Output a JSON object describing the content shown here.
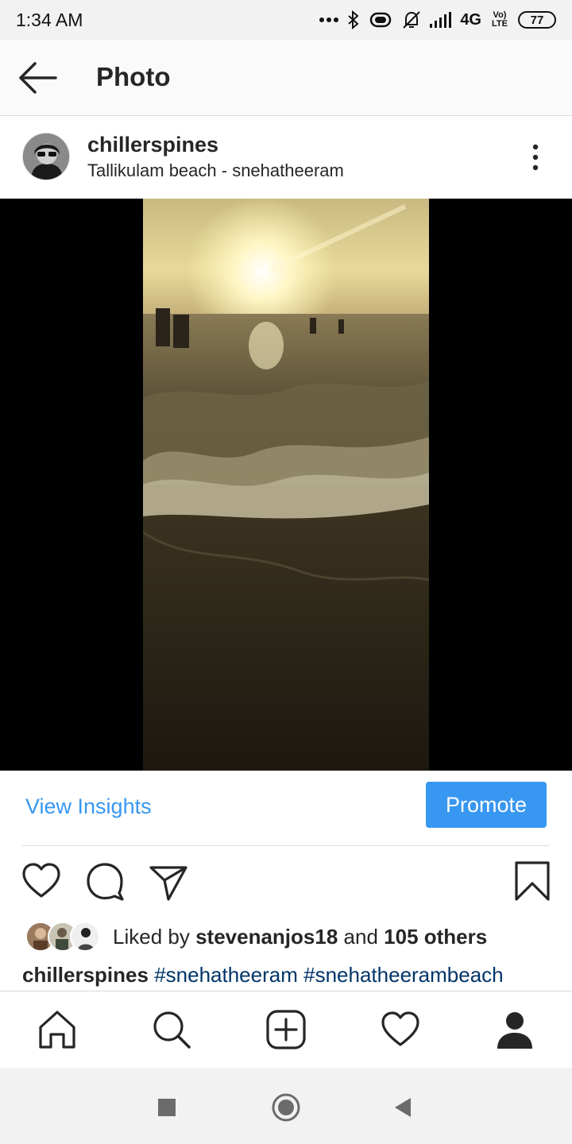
{
  "status_bar": {
    "time": "1:34 AM",
    "network": "4G",
    "lte_label": "Vo) LTE",
    "battery": "77",
    "icons": [
      "dots-icon",
      "bluetooth-icon",
      "vibrate-icon",
      "mute-icon",
      "signal-icon"
    ]
  },
  "header": {
    "title": "Photo",
    "back_icon": "arrow-left-icon"
  },
  "post": {
    "username": "chillerspines",
    "location": "Tallikulam beach - snehatheeram",
    "more_icon": "more-vertical-icon"
  },
  "insights": {
    "view_insights_label": "View Insights",
    "promote_label": "Promote"
  },
  "actions": [
    "heart-icon",
    "comment-icon",
    "send-icon",
    "bookmark-icon"
  ],
  "likes": {
    "prefix": "Liked by",
    "user": "stevenanjos18",
    "middle": "and",
    "others": "105 others"
  },
  "caption": {
    "username": "chillerspines",
    "hashtags": [
      "#snehatheeram",
      "#snehatheerambeach"
    ]
  },
  "bottom_nav": [
    "home-icon",
    "search-icon",
    "add-post-icon",
    "activity-heart-icon",
    "profile-icon"
  ],
  "system_nav": [
    "recents-square-icon",
    "home-circle-icon",
    "back-triangle-icon"
  ],
  "colors": {
    "accent": "#3897f0",
    "hashtag": "#003569",
    "text": "#262626",
    "divider": "#dbdbdb"
  }
}
